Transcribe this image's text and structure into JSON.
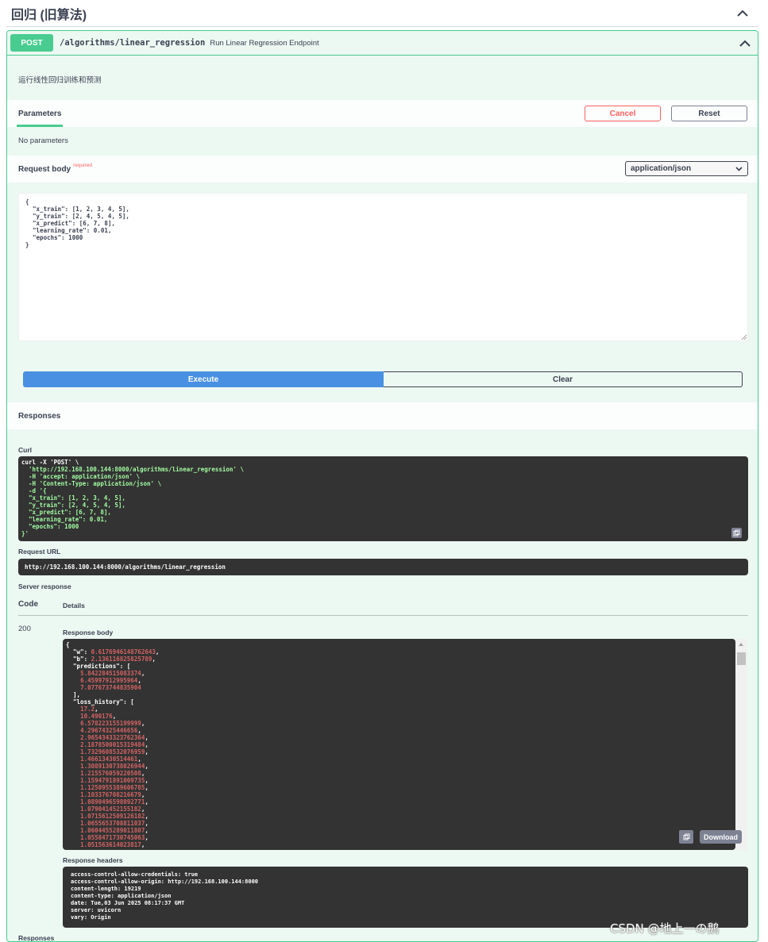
{
  "tag": {
    "title": "回归 (旧算法)"
  },
  "operation": {
    "method": "POST",
    "path": "/algorithms/linear_regression",
    "summary": "Run Linear Regression Endpoint",
    "description": "运行线性回归训练和预测"
  },
  "parameters": {
    "title": "Parameters",
    "cancel_label": "Cancel",
    "reset_label": "Reset",
    "empty_text": "No parameters"
  },
  "request_body": {
    "title": "Request body",
    "required_label": "required",
    "content_type": "application/json",
    "value": "{\n  \"x_train\": [1, 2, 3, 4, 5],\n  \"y_train\": [2, 4, 5, 4, 5],\n  \"x_predict\": [6, 7, 8],\n  \"learning_rate\": 0.01,\n  \"epochs\": 1000\n}"
  },
  "actions": {
    "execute_label": "Execute",
    "clear_label": "Clear"
  },
  "responses": {
    "title": "Responses",
    "curl_label": "Curl",
    "curl_lines": [
      "curl -X 'POST' \\",
      "  'http://192.168.100.144:8000/algorithms/linear_regression' \\",
      "  -H 'accept: application/json' \\",
      "  -H 'Content-Type: application/json' \\",
      "  -d '{",
      "  \"x_train\": [1, 2, 3, 4, 5],",
      "  \"y_train\": [2, 4, 5, 4, 5],",
      "  \"x_predict\": [6, 7, 8],",
      "  \"learning_rate\": 0.01,",
      "  \"epochs\": 1000",
      "}'"
    ],
    "request_url_label": "Request URL",
    "request_url": "http://192.168.100.144:8000/algorithms/linear_regression",
    "server_response_label": "Server response",
    "code_header": "Code",
    "details_header": "Details",
    "status_code": "200",
    "response_body_label": "Response body",
    "body": {
      "w": "0.6176946148762643",
      "b": "2.136116825825789",
      "predictions": [
        "5.842284515083374",
        "6.45997912995964",
        "7.077673744835904"
      ],
      "loss_history": [
        "17.2",
        "10.490176",
        "6.578223155199999",
        "4.29674325446656",
        "2.9654343323762364",
        "2.1878500015319484",
        "1.7329608532076959",
        "1.46613430514461",
        "1.3089130738026944",
        "1.215576059220508",
        "1.1594791891009735",
        "1.1250955389606785",
        "1.103376708216679",
        "1.0890496598092771",
        "1.079041452155182",
        "1.0715612509126182",
        "1.0655653708811037",
        "1.0604455289011807",
        "1.0558471730745063",
        "1.051563614023817"
      ]
    },
    "download_label": "Download",
    "response_headers_label": "Response headers",
    "headers": [
      "access-control-allow-credentials: true",
      "access-control-allow-origin: http://192.168.100.144:8000",
      "content-length: 19219",
      "content-type: application/json",
      "date: Tue,03 Jun 2025 08:17:37 GMT",
      "server: uvicorn",
      "vary: Origin"
    ],
    "footer_label": "Responses"
  },
  "watermark": "CSDN @地上一の鹅",
  "icons": {
    "collapse": "chevron-up-icon",
    "dropdown": "chevron-down-icon",
    "copy": "copy-icon"
  },
  "colors": {
    "post": "#49cc90",
    "execute": "#4990e2",
    "cancel": "#ff6060",
    "code_bg": "#333333",
    "number": "#d36363",
    "string": "#a2fca2"
  }
}
